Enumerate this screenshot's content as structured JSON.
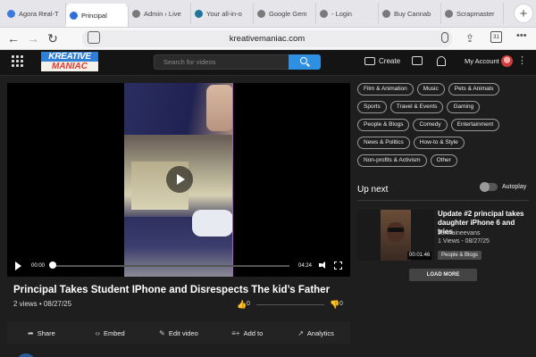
{
  "browser": {
    "tabs": [
      {
        "label": "Agora Real-T",
        "color": "#3b7be0",
        "active": false
      },
      {
        "label": "Principal",
        "color": "#2f6fd6",
        "active": true
      },
      {
        "label": "Admin ‹ Live",
        "color": "#7a7a7a",
        "active": false
      },
      {
        "label": "Your all-in-o",
        "color": "#21759b",
        "active": false
      },
      {
        "label": "Google Gem",
        "color": "#7a7a7a",
        "active": false
      },
      {
        "label": "- Login",
        "color": "#7a7a7a",
        "active": false
      },
      {
        "label": "Buy Cannab",
        "color": "#7a7a7a",
        "active": false
      },
      {
        "label": "Scrapmaster",
        "color": "#7a7a7a",
        "active": false
      }
    ],
    "url": "kreativemaniac.com",
    "calendar_badge": "31"
  },
  "site": {
    "logo_top": "KREATIVE",
    "logo_bottom": "MANIAC",
    "search_placeholder": "Search for videos",
    "create_label": "Create",
    "account_label": "My Account"
  },
  "player": {
    "current_time": "00:00",
    "duration": "04:24",
    "progress_fraction": 0.0
  },
  "video": {
    "title": "Principal Takes Student IPhone and Disrespects The kid’s Father",
    "meta": "2 views  •  08/27/25",
    "likes": "0",
    "dislikes": "0"
  },
  "actions": [
    {
      "label": "Share",
      "icon": "share-icon",
      "glyph": "➦"
    },
    {
      "label": "Embed",
      "icon": "embed-icon",
      "glyph": "‹›"
    },
    {
      "label": "Edit video",
      "icon": "edit-icon",
      "glyph": "✎"
    },
    {
      "label": "Add to",
      "icon": "add-icon",
      "glyph": "≡+"
    },
    {
      "label": "Analytics",
      "icon": "analytics-icon",
      "glyph": "↗"
    }
  ],
  "categories": [
    "Film & Animation",
    "Music",
    "Pets & Animals",
    "Sports",
    "Travel & Events",
    "Gaming",
    "People & Blogs",
    "Comedy",
    "Entertainment",
    "News & Politics",
    "How-to & Style",
    "Non-profits & Activism",
    "Other"
  ],
  "upnext": {
    "label": "Up next",
    "autoplay_label": "Autoplay",
    "autoplay_on": false
  },
  "recommendation": {
    "title": "Update #2 principal takes daughter iPhone 6 and tries",
    "author": "Jermaineevans",
    "stats": "1 Views - 08/27/25",
    "duration": "00:01:46",
    "category": "People & Blogs"
  },
  "load_more_label": "LOAD MORE"
}
